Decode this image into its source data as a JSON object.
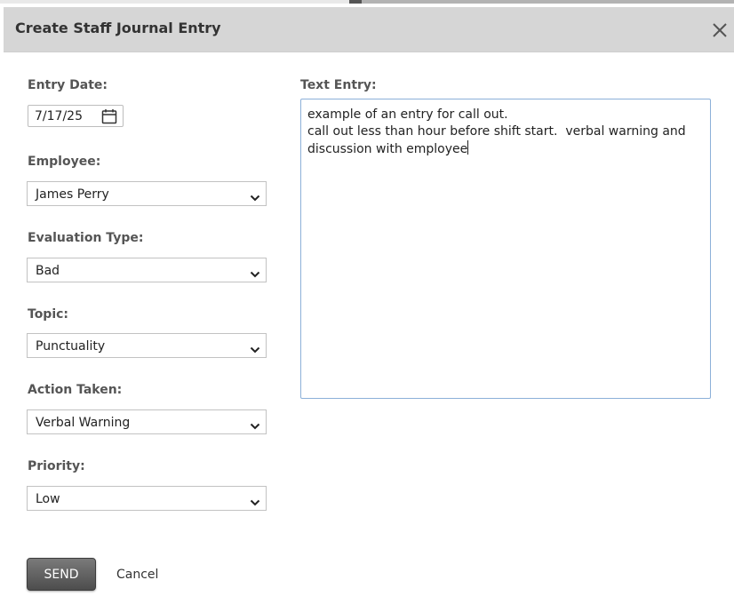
{
  "dialog": {
    "title": "Create Staff Journal Entry",
    "close_icon": "close-icon"
  },
  "form": {
    "entry_date": {
      "label": "Entry Date:",
      "value": "7/17/25",
      "icon": "calendar-icon"
    },
    "employee": {
      "label": "Employee:",
      "value": "James Perry"
    },
    "evaluation_type": {
      "label": "Evaluation Type:",
      "value": "Bad"
    },
    "topic": {
      "label": "Topic:",
      "value": "Punctuality"
    },
    "action_taken": {
      "label": "Action Taken:",
      "value": "Verbal Warning"
    },
    "priority": {
      "label": "Priority:",
      "value": "Low"
    },
    "text_entry": {
      "label": "Text Entry:",
      "lines": [
        "example of an entry for call out.",
        "call out less than hour before shift start.  verbal warning and",
        "discussion with employee"
      ]
    }
  },
  "actions": {
    "send_label": "SEND",
    "cancel_label": "Cancel"
  },
  "colors": {
    "titlebar_bg": "#d6d6d6",
    "textarea_focus_border": "#8cb0d9",
    "send_button_bg": "#5a5a5a"
  }
}
